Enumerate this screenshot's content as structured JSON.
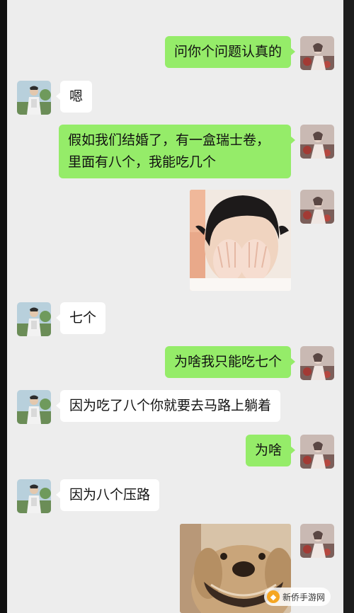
{
  "messages": {
    "m1": "问你个问题认真的",
    "m2": "嗯",
    "m3_line1": "假如我们结婚了，有一盒瑞士卷，",
    "m3_line2": "里面有八个，我能吃几个",
    "m5": "七个",
    "m6": "为啥我只能吃七个",
    "m7": "因为吃了八个你就要去马路上躺着",
    "m8": "为啥",
    "m9": "因为八个压路"
  },
  "stickers": {
    "s1": "child-covering-face-sticker",
    "s2": "smiling-dog-sticker"
  },
  "watermark": {
    "text": "新侨手游网"
  },
  "colors": {
    "sent_bubble": "#95ec69",
    "received_bubble": "#ffffff",
    "chat_background": "#ededed"
  }
}
